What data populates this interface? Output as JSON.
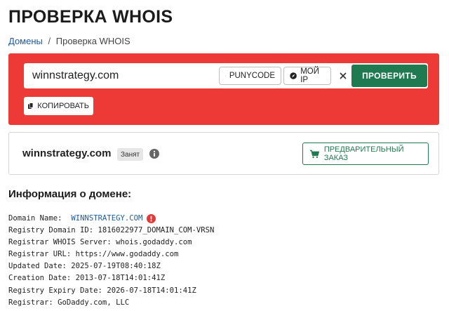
{
  "page": {
    "title": "ПРОВЕРКА WHOIS"
  },
  "breadcrumb": {
    "link": "Домены",
    "separator": "/",
    "current": "Проверка WHOIS"
  },
  "search": {
    "value": "winnstrategy.com",
    "punycode_label": "PUNYCODE",
    "myip_label": "МОЙ IP",
    "clear_symbol": "✕",
    "submit_label": "ПРОВЕРИТЬ",
    "copy_label": "КОПИРОВАТЬ"
  },
  "result": {
    "domain": "winnstrategy.com",
    "status": "Занят",
    "preorder_label": "ПРЕДВАРИТЕЛЬНЫЙ ЗАКАЗ"
  },
  "whois": {
    "heading": "Информация о домене:",
    "domain_label": "Domain Name:",
    "domain_value": "WINNSTRATEGY.COM",
    "lines": [
      "Registry Domain ID: 1816022977_DOMAIN_COM-VRSN",
      "Registrar WHOIS Server: whois.godaddy.com",
      "Registrar URL: https://www.godaddy.com",
      "Updated Date: 2025-07-19T08:40:18Z",
      "Creation Date: 2013-07-18T14:01:41Z",
      "Registry Expiry Date: 2026-07-18T14:01:41Z",
      "Registrar: GoDaddy.com, LLC"
    ]
  },
  "colors": {
    "panel_red": "#ee3a36",
    "accent_green": "#1f7a52",
    "link_blue": "#1e5a9e",
    "warn_red": "#e03a3a"
  },
  "icons": [
    "refresh-icon",
    "compass-icon",
    "close-icon",
    "copy-icon",
    "info-icon",
    "cart-icon",
    "warning-icon"
  ]
}
